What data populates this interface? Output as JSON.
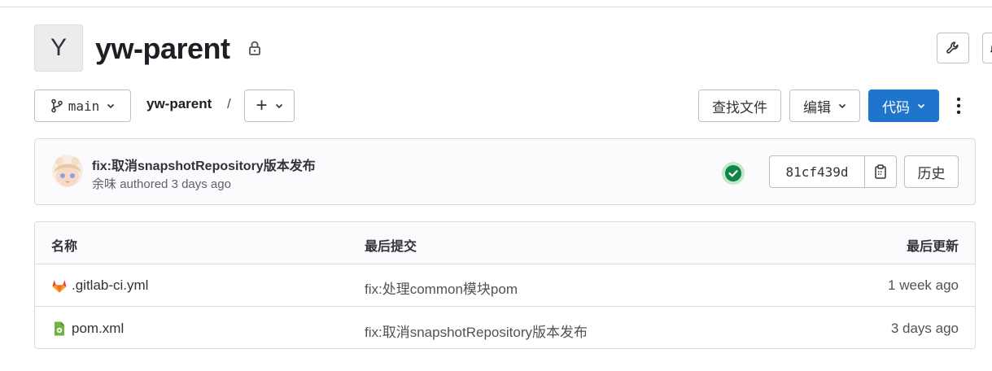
{
  "project": {
    "avatar_letter": "Y",
    "name": "yw-parent"
  },
  "toolbar": {
    "branch": "main",
    "breadcrumb_repo": "yw-parent",
    "breadcrumb_sep": "/",
    "add_label": "+",
    "find_file": "查找文件",
    "edit": "编辑",
    "code": "代码"
  },
  "last_commit": {
    "title": "fix:取消snapshotRepository版本发布",
    "author": "余味",
    "authored": "authored 3 days ago",
    "sha": "81cf439d",
    "history": "历史",
    "pipeline_status": "passed"
  },
  "table": {
    "headers": [
      "名称",
      "最后提交",
      "最后更新"
    ],
    "rows": [
      {
        "name": ".gitlab-ci.yml",
        "commit": "fix:处理common模块pom",
        "updated": "1 week ago",
        "icon": "gitlab-icon"
      },
      {
        "name": "pom.xml",
        "commit": "fix:取消snapshotRepository版本发布",
        "updated": "3 days ago",
        "icon": "xml-file-icon"
      }
    ]
  },
  "colors": {
    "primary": "#1f75cb",
    "success": "#108548",
    "border": "#dcdcde"
  }
}
